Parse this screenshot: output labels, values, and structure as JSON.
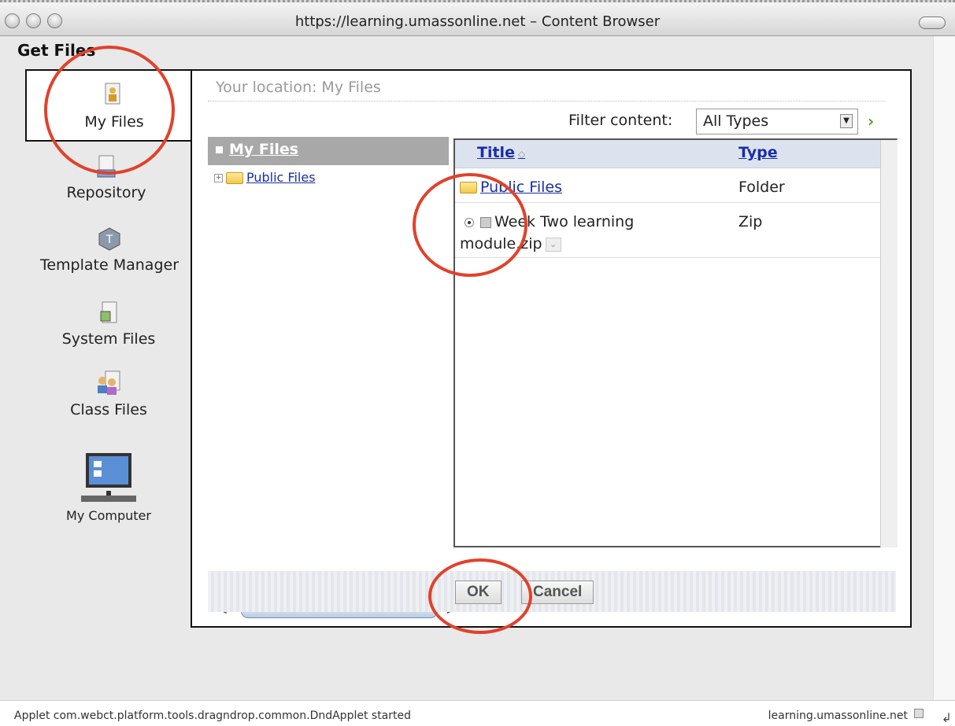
{
  "window": {
    "title": "https://learning.umassonline.net – Content Browser"
  },
  "dialog": {
    "heading": "Get Files"
  },
  "nav": {
    "items": [
      {
        "label": "My Files",
        "icon": "my-files-icon"
      },
      {
        "label": "Repository",
        "icon": "repository-icon"
      },
      {
        "label": "Template Manager",
        "icon": "template-manager-icon"
      },
      {
        "label": "System Files",
        "icon": "system-files-icon"
      },
      {
        "label": "Class Files",
        "icon": "class-files-icon"
      },
      {
        "label": "My Computer",
        "icon": "my-computer-icon"
      }
    ],
    "selected": "My Files"
  },
  "location": {
    "text": "Your location: My Files"
  },
  "filter": {
    "label": "Filter content:",
    "selected": "All Types"
  },
  "tree": {
    "root": "My Files",
    "children": [
      "Public Files"
    ]
  },
  "list": {
    "columns": {
      "title": "Title",
      "type": "Type"
    },
    "rows": [
      {
        "title": "Public Files",
        "type": "Folder"
      },
      {
        "title": "Week Two learning module.zip",
        "type": "Zip"
      }
    ]
  },
  "buttons": {
    "ok": "OK",
    "cancel": "Cancel"
  },
  "status": {
    "left": "Applet com.webct.platform.tools.dragndrop.common.DndApplet started",
    "right": "learning.umassonline.net"
  },
  "colors": {
    "annotation": "#e0422b",
    "link": "#1a2ea8",
    "tree_header": "#a8a8a8"
  }
}
